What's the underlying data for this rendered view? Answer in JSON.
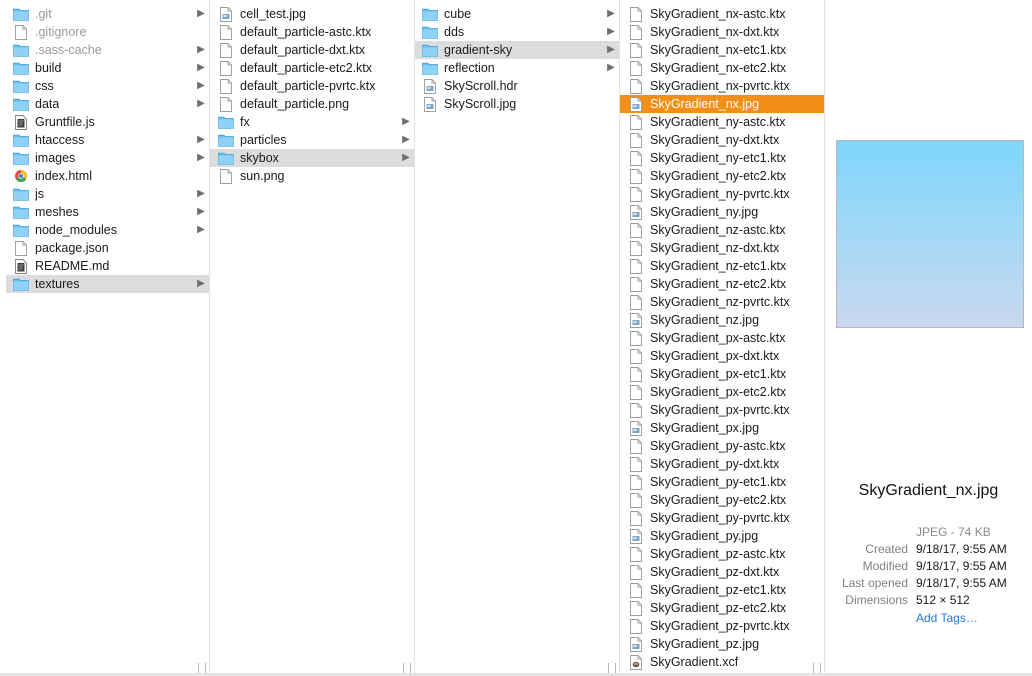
{
  "columns": [
    {
      "id": "col1",
      "items": [
        {
          "name": ".git",
          "type": "folder",
          "dim": true,
          "arrow": true
        },
        {
          "name": ".gitignore",
          "type": "file",
          "dim": true
        },
        {
          "name": ".sass-cache",
          "type": "folder",
          "dim": true,
          "arrow": true
        },
        {
          "name": "build",
          "type": "folder",
          "arrow": true
        },
        {
          "name": "css",
          "type": "folder",
          "arrow": true
        },
        {
          "name": "data",
          "type": "folder",
          "arrow": true
        },
        {
          "name": "Gruntfile.js",
          "type": "script"
        },
        {
          "name": "htaccess",
          "type": "folder",
          "arrow": true
        },
        {
          "name": "images",
          "type": "folder",
          "arrow": true
        },
        {
          "name": "index.html",
          "type": "html"
        },
        {
          "name": "js",
          "type": "folder",
          "arrow": true
        },
        {
          "name": "meshes",
          "type": "folder",
          "arrow": true
        },
        {
          "name": "node_modules",
          "type": "folder",
          "arrow": true
        },
        {
          "name": "package.json",
          "type": "file"
        },
        {
          "name": "README.md",
          "type": "script"
        },
        {
          "name": "textures",
          "type": "folder",
          "arrow": true,
          "selected": true
        }
      ]
    },
    {
      "id": "col2",
      "items": [
        {
          "name": "cell_test.jpg",
          "type": "image"
        },
        {
          "name": "default_particle-astc.ktx",
          "type": "file"
        },
        {
          "name": "default_particle-dxt.ktx",
          "type": "file"
        },
        {
          "name": "default_particle-etc2.ktx",
          "type": "file"
        },
        {
          "name": "default_particle-pvrtc.ktx",
          "type": "file"
        },
        {
          "name": "default_particle.png",
          "type": "file"
        },
        {
          "name": "fx",
          "type": "folder",
          "arrow": true
        },
        {
          "name": "particles",
          "type": "folder",
          "arrow": true
        },
        {
          "name": "skybox",
          "type": "folder",
          "arrow": true,
          "selected": true
        },
        {
          "name": "sun.png",
          "type": "file"
        }
      ]
    },
    {
      "id": "col3",
      "items": [
        {
          "name": "cube",
          "type": "folder",
          "arrow": true
        },
        {
          "name": "dds",
          "type": "folder",
          "arrow": true
        },
        {
          "name": "gradient-sky",
          "type": "folder",
          "arrow": true,
          "selected": true
        },
        {
          "name": "reflection",
          "type": "folder",
          "arrow": true
        },
        {
          "name": "SkyScroll.hdr",
          "type": "image"
        },
        {
          "name": "SkyScroll.jpg",
          "type": "image"
        }
      ]
    },
    {
      "id": "col4",
      "items": [
        {
          "name": "SkyGradient_nx-astc.ktx",
          "type": "file"
        },
        {
          "name": "SkyGradient_nx-dxt.ktx",
          "type": "file"
        },
        {
          "name": "SkyGradient_nx-etc1.ktx",
          "type": "file"
        },
        {
          "name": "SkyGradient_nx-etc2.ktx",
          "type": "file"
        },
        {
          "name": "SkyGradient_nx-pvrtc.ktx",
          "type": "file"
        },
        {
          "name": "SkyGradient_nx.jpg",
          "type": "image",
          "active": true
        },
        {
          "name": "SkyGradient_ny-astc.ktx",
          "type": "file"
        },
        {
          "name": "SkyGradient_ny-dxt.ktx",
          "type": "file"
        },
        {
          "name": "SkyGradient_ny-etc1.ktx",
          "type": "file"
        },
        {
          "name": "SkyGradient_ny-etc2.ktx",
          "type": "file"
        },
        {
          "name": "SkyGradient_ny-pvrtc.ktx",
          "type": "file"
        },
        {
          "name": "SkyGradient_ny.jpg",
          "type": "image"
        },
        {
          "name": "SkyGradient_nz-astc.ktx",
          "type": "file"
        },
        {
          "name": "SkyGradient_nz-dxt.ktx",
          "type": "file"
        },
        {
          "name": "SkyGradient_nz-etc1.ktx",
          "type": "file"
        },
        {
          "name": "SkyGradient_nz-etc2.ktx",
          "type": "file"
        },
        {
          "name": "SkyGradient_nz-pvrtc.ktx",
          "type": "file"
        },
        {
          "name": "SkyGradient_nz.jpg",
          "type": "image"
        },
        {
          "name": "SkyGradient_px-astc.ktx",
          "type": "file"
        },
        {
          "name": "SkyGradient_px-dxt.ktx",
          "type": "file"
        },
        {
          "name": "SkyGradient_px-etc1.ktx",
          "type": "file"
        },
        {
          "name": "SkyGradient_px-etc2.ktx",
          "type": "file"
        },
        {
          "name": "SkyGradient_px-pvrtc.ktx",
          "type": "file"
        },
        {
          "name": "SkyGradient_px.jpg",
          "type": "image"
        },
        {
          "name": "SkyGradient_py-astc.ktx",
          "type": "file"
        },
        {
          "name": "SkyGradient_py-dxt.ktx",
          "type": "file"
        },
        {
          "name": "SkyGradient_py-etc1.ktx",
          "type": "file"
        },
        {
          "name": "SkyGradient_py-etc2.ktx",
          "type": "file"
        },
        {
          "name": "SkyGradient_py-pvrtc.ktx",
          "type": "file"
        },
        {
          "name": "SkyGradient_py.jpg",
          "type": "image"
        },
        {
          "name": "SkyGradient_pz-astc.ktx",
          "type": "file"
        },
        {
          "name": "SkyGradient_pz-dxt.ktx",
          "type": "file"
        },
        {
          "name": "SkyGradient_pz-etc1.ktx",
          "type": "file"
        },
        {
          "name": "SkyGradient_pz-etc2.ktx",
          "type": "file"
        },
        {
          "name": "SkyGradient_pz-pvrtc.ktx",
          "type": "file"
        },
        {
          "name": "SkyGradient_pz.jpg",
          "type": "image"
        },
        {
          "name": "SkyGradient.xcf",
          "type": "xcf"
        }
      ]
    }
  ],
  "preview": {
    "filename": "SkyGradient_nx.jpg",
    "kind": "JPEG - 74 KB",
    "meta": [
      {
        "key": "Created",
        "value": "9/18/17, 9:55 AM"
      },
      {
        "key": "Modified",
        "value": "9/18/17, 9:55 AM"
      },
      {
        "key": "Last opened",
        "value": "9/18/17, 9:55 AM"
      },
      {
        "key": "Dimensions",
        "value": "512 × 512"
      }
    ],
    "add_tags": "Add Tags…"
  },
  "colors": {
    "selection_active": "#f38f16",
    "selection_inactive": "#dcdcdc",
    "folder": "#5bb8ee",
    "link": "#2d7ad8"
  }
}
